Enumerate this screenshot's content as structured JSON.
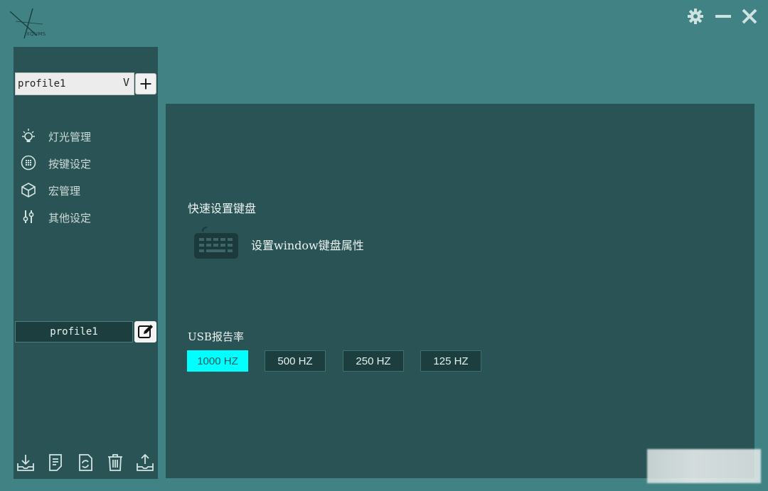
{
  "logo": {
    "text": "XQUMS"
  },
  "window_controls": {
    "settings_icon": "gear-icon",
    "minimize_icon": "minimize-icon",
    "close_icon": "close-icon"
  },
  "sidebar": {
    "profile_select": {
      "value": "profile1",
      "arrow": "V"
    },
    "add_profile_label": "+",
    "nav_items": [
      {
        "label": "灯光管理",
        "icon": "bulb-icon"
      },
      {
        "label": "按键设定",
        "icon": "keypad-icon"
      },
      {
        "label": "宏管理",
        "icon": "cube-icon"
      },
      {
        "label": "其他设定",
        "icon": "sliders-icon"
      }
    ],
    "profile_name_value": "profile1",
    "edit_icon": "edit-icon",
    "toolbar": [
      {
        "icon": "import-icon"
      },
      {
        "icon": "document-icon"
      },
      {
        "icon": "refresh-icon"
      },
      {
        "icon": "trash-icon"
      },
      {
        "icon": "export-icon"
      }
    ]
  },
  "main": {
    "quick_title": "快速设置键盘",
    "keyboard_link": "设置window键盘属性",
    "usb_title": "USB报告率",
    "rates": [
      {
        "label": "1000 HZ",
        "active": true
      },
      {
        "label": "500 HZ",
        "active": false
      },
      {
        "label": "250 HZ",
        "active": false
      },
      {
        "label": "125 HZ",
        "active": false
      }
    ]
  },
  "colors": {
    "background": "#418384",
    "panel": "#295354",
    "accent": "#00ffff",
    "button_dark": "#1c3e3f"
  }
}
